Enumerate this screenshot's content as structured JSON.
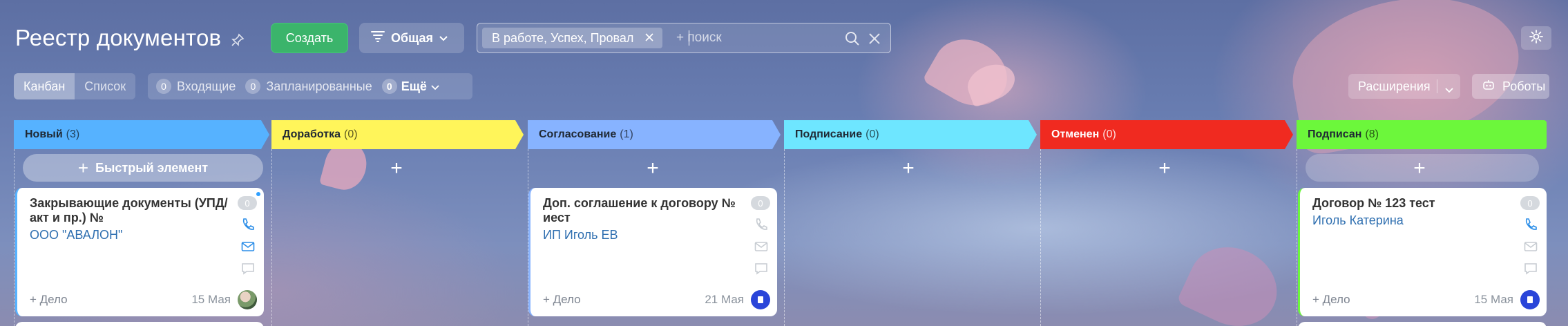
{
  "header": {
    "title": "Реестр документов",
    "create_label": "Создать",
    "general_label": "Общая",
    "filter_chip": "В работе, Успех, Провал",
    "search_placeholder": "+ поиск"
  },
  "toolbar": {
    "views": [
      "Канбан",
      "Список"
    ],
    "counters": [
      {
        "count": "0",
        "label": "Входящие"
      },
      {
        "count": "0",
        "label": "Запланированные"
      },
      {
        "count": "0",
        "label": "Ещё"
      }
    ],
    "extensions_label": "Расширения",
    "robots_label": "Роботы"
  },
  "columns": [
    {
      "name": "Новый",
      "count": "(3)",
      "color": "#56b2ff"
    },
    {
      "name": "Доработка",
      "count": "(0)",
      "color": "#fff55a"
    },
    {
      "name": "Согласование",
      "count": "(1)",
      "color": "#87b3ff"
    },
    {
      "name": "Подписание",
      "count": "(0)",
      "color": "#6ee6ff"
    },
    {
      "name": "Отменен",
      "count": "(0)",
      "color": "#f02a20"
    },
    {
      "name": "Подписан",
      "count": "(8)",
      "color": "#6cf73b"
    }
  ],
  "quick_add_label": "Быстрый элемент",
  "cards": [
    {
      "title": "Закрывающие документы (УПД/акт и пр.) №",
      "client": "ООО \"АВАЛОН\"",
      "deal": "+ Дело",
      "date": "15 Мая",
      "badge": "0"
    },
    {
      "title": "Доп. соглашение к договору № иест",
      "client": "ИП Иголь ЕВ",
      "deal": "+ Дело",
      "date": "21 Мая",
      "badge": "0"
    },
    {
      "title": "Договор № 123 тест",
      "client": "Иголь Катерина",
      "deal": "+ Дело",
      "date": "15 Мая",
      "badge": "0"
    }
  ]
}
